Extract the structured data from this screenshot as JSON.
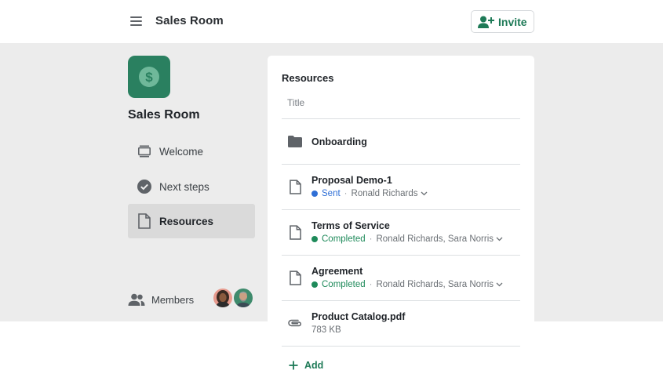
{
  "header": {
    "menu_icon": "hamburger-menu-icon",
    "title": "Sales Room",
    "invite_label": "Invite",
    "invite_icon": "add-person-icon"
  },
  "room": {
    "logo_icon": "dollar-coin-icon",
    "name": "Sales Room"
  },
  "nav": {
    "items": [
      {
        "label": "Welcome",
        "icon": "welcome-stack-icon",
        "active": false
      },
      {
        "label": "Next steps",
        "icon": "checkmark-circle-icon",
        "active": false
      },
      {
        "label": "Resources",
        "icon": "document-icon",
        "active": true
      }
    ]
  },
  "members": {
    "label": "Members",
    "icon": "people-icon"
  },
  "resources": {
    "title": "Resources",
    "column_title": "Title",
    "items": [
      {
        "title": "Onboarding",
        "icon": "folder-icon"
      },
      {
        "title": "Proposal Demo-1",
        "icon": "document-icon",
        "status": "Sent",
        "people": "Ronald Richards"
      },
      {
        "title": "Terms of Service",
        "icon": "document-icon",
        "status": "Completed",
        "people": "Ronald Richards, Sara Norris"
      },
      {
        "title": "Agreement",
        "icon": "document-icon",
        "status": "Completed",
        "people": "Ronald Richards, Sara Norris"
      },
      {
        "title": "Product Catalog.pdf",
        "icon": "paperclip-icon",
        "size": "783 KB"
      }
    ],
    "add_label": "Add"
  },
  "colors": {
    "brand_green": "#2a8060",
    "accent_green": "#1e7a57",
    "sent_blue": "#2f6fd6",
    "completed_green": "#1e8a5a",
    "band_gray": "#ececec"
  }
}
